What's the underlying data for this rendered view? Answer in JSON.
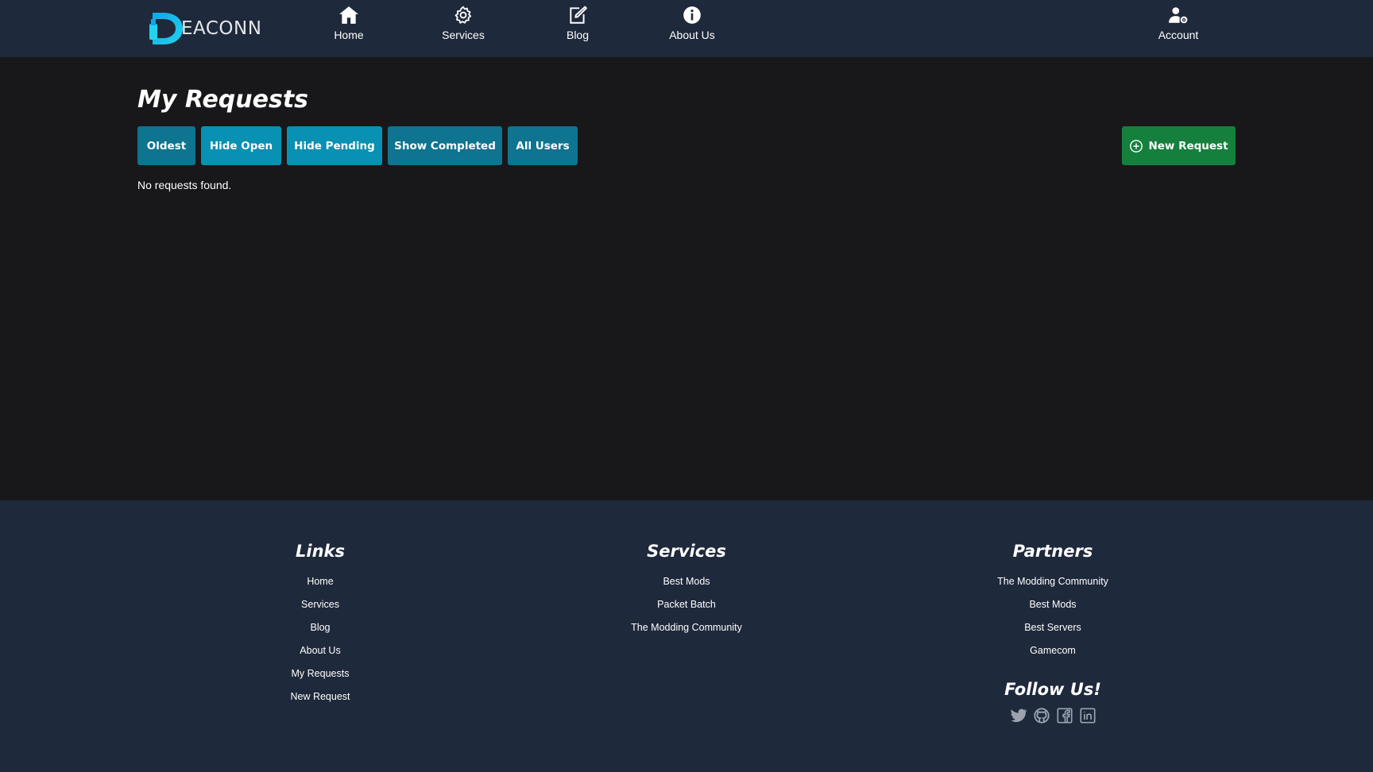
{
  "brand": {
    "logo_text": "EACONN",
    "accent": "#22d3ee"
  },
  "nav": {
    "items": [
      {
        "label": "Home",
        "icon": "home-icon"
      },
      {
        "label": "Services",
        "icon": "gear-icon"
      },
      {
        "label": "Blog",
        "icon": "edit-icon"
      },
      {
        "label": "About Us",
        "icon": "info-icon"
      }
    ],
    "account": {
      "label": "Account",
      "icon": "user-gear-icon"
    }
  },
  "main": {
    "title": "My Requests",
    "filters": [
      {
        "label": "Oldest"
      },
      {
        "label": "Hide Open"
      },
      {
        "label": "Hide Pending"
      },
      {
        "label": "Show Completed"
      },
      {
        "label": "All Users"
      }
    ],
    "new_request_label": "New Request",
    "empty_message": "No requests found."
  },
  "footer": {
    "links": {
      "heading": "Links",
      "items": [
        "Home",
        "Services",
        "Blog",
        "About Us",
        "My Requests",
        "New Request"
      ]
    },
    "services": {
      "heading": "Services",
      "items": [
        "Best Mods",
        "Packet Batch",
        "The Modding Community"
      ]
    },
    "partners": {
      "heading": "Partners",
      "items": [
        "The Modding Community",
        "Best Mods",
        "Best Servers",
        "Gamecom"
      ]
    },
    "follow": {
      "heading": "Follow Us!",
      "icons": [
        "twitter-icon",
        "github-icon",
        "facebook-icon",
        "linkedin-icon"
      ]
    }
  },
  "colors": {
    "nav_bg": "#1e293b",
    "page_bg": "#18181b",
    "filter_dark": "#0e7490",
    "filter_light": "#0891b2",
    "new_request": "#15803d"
  }
}
